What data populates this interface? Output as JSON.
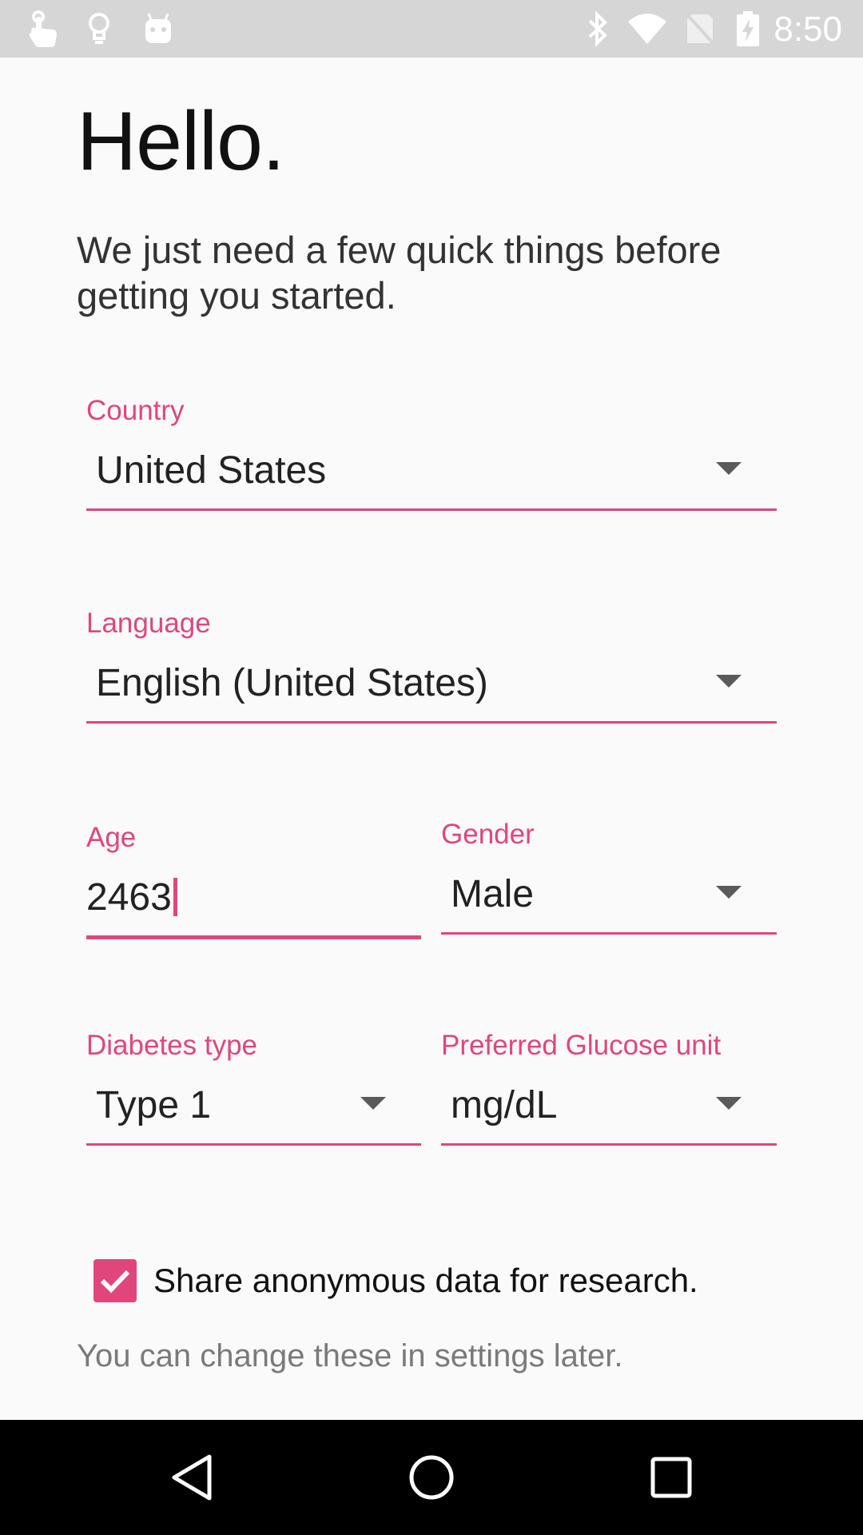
{
  "status_bar": {
    "time": "8:50",
    "left_icons": [
      "touch-icon",
      "lightbulb-icon",
      "android-icon"
    ],
    "right_icons": [
      "bluetooth-icon",
      "wifi-icon",
      "no-sim-icon",
      "battery-charging-icon"
    ]
  },
  "header": {
    "title": "Hello.",
    "subtitle": "We just need a few quick things before getting you started."
  },
  "form": {
    "country": {
      "label": "Country",
      "value": "United States"
    },
    "language": {
      "label": "Language",
      "value": "English (United States)"
    },
    "age": {
      "label": "Age",
      "value": "2463"
    },
    "gender": {
      "label": "Gender",
      "value": "Male"
    },
    "diabetes_type": {
      "label": "Diabetes type",
      "value": "Type 1"
    },
    "glucose_unit": {
      "label": "Preferred Glucose unit",
      "value": "mg/dL"
    },
    "share_data": {
      "label": "Share anonymous data for research.",
      "checked": true
    },
    "note": "You can change these in settings later."
  },
  "colors": {
    "accent": "#e0467c",
    "background": "#fafafa",
    "status_bar": "#d6d6d6",
    "nav_bar": "#000000"
  },
  "nav_bar": {
    "buttons": [
      "back-icon",
      "home-icon",
      "recents-icon"
    ]
  }
}
